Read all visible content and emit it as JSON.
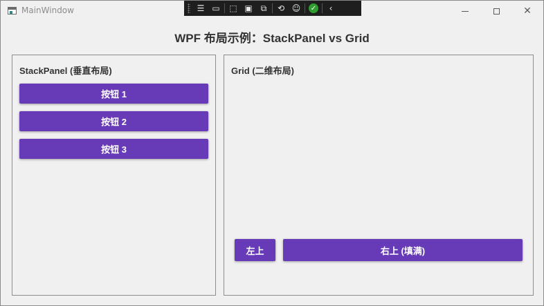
{
  "window": {
    "title": "MainWindow",
    "controls": {
      "minimize": "minimize",
      "maximize": "maximize",
      "close": "close"
    }
  },
  "devtoolbar": {
    "tools": [
      "live-visual-tree-icon",
      "record-icon",
      "select-element-icon",
      "display-layout-adorners-icon",
      "track-focused-element-icon",
      "hot-reload-icon",
      "accessibility-icon",
      "ok-check-icon",
      "collapse-icon"
    ]
  },
  "heading": "WPF 布局示例：StackPanel vs Grid",
  "left_panel": {
    "label": "StackPanel (垂直布局)",
    "buttons": [
      "按钮 1",
      "按钮 2",
      "按钮 3"
    ]
  },
  "right_panel": {
    "label": "Grid (二维布局)",
    "buttons": [
      "左上",
      "右上 (填满)"
    ]
  },
  "colors": {
    "accent": "#673ab7",
    "background": "#f0f0f0",
    "border": "#8c8c8c",
    "heading_text": "#333333"
  }
}
